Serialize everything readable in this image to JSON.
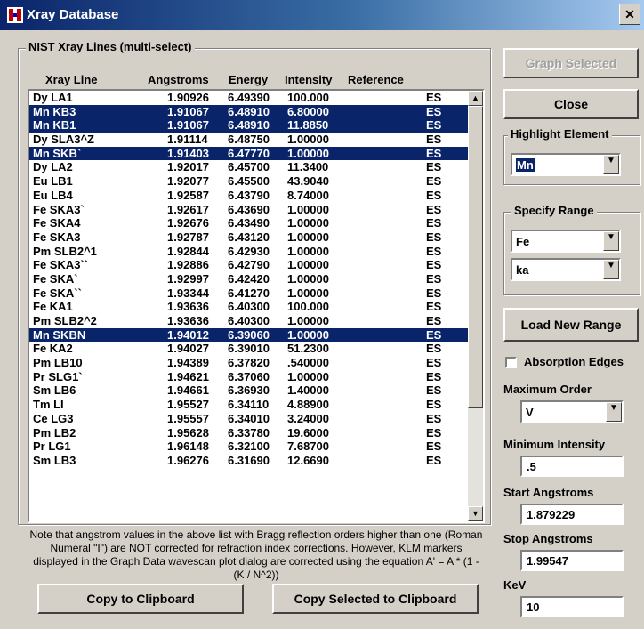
{
  "window": {
    "title": "Xray Database"
  },
  "group_nist": {
    "label": "NIST Xray Lines (multi-select)"
  },
  "columns": [
    "Xray Line",
    "Angstroms",
    "Energy",
    "Intensity",
    "Reference"
  ],
  "rows": [
    {
      "line": "Dy LA1",
      "ang": "1.90926",
      "energy": "6.49390",
      "intensity": "100.000",
      "ref": "ES",
      "selected": false
    },
    {
      "line": "Mn KB3",
      "ang": "1.91067",
      "energy": "6.48910",
      "intensity": "6.80000",
      "ref": "ES",
      "selected": true
    },
    {
      "line": "Mn KB1",
      "ang": "1.91067",
      "energy": "6.48910",
      "intensity": "11.8850",
      "ref": "ES",
      "selected": true
    },
    {
      "line": "Dy SLA3^Z",
      "ang": "1.91114",
      "energy": "6.48750",
      "intensity": "1.00000",
      "ref": "ES",
      "selected": false
    },
    {
      "line": "Mn SKB`",
      "ang": "1.91403",
      "energy": "6.47770",
      "intensity": "1.00000",
      "ref": "ES",
      "selected": true
    },
    {
      "line": "Dy LA2",
      "ang": "1.92017",
      "energy": "6.45700",
      "intensity": "11.3400",
      "ref": "ES",
      "selected": false
    },
    {
      "line": "Eu LB1",
      "ang": "1.92077",
      "energy": "6.45500",
      "intensity": "43.9040",
      "ref": "ES",
      "selected": false
    },
    {
      "line": "Eu LB4",
      "ang": "1.92587",
      "energy": "6.43790",
      "intensity": "8.74000",
      "ref": "ES",
      "selected": false
    },
    {
      "line": "Fe SKA3`",
      "ang": "1.92617",
      "energy": "6.43690",
      "intensity": "1.00000",
      "ref": "ES",
      "selected": false
    },
    {
      "line": "Fe SKA4",
      "ang": "1.92676",
      "energy": "6.43490",
      "intensity": "1.00000",
      "ref": "ES",
      "selected": false
    },
    {
      "line": "Fe SKA3",
      "ang": "1.92787",
      "energy": "6.43120",
      "intensity": "1.00000",
      "ref": "ES",
      "selected": false
    },
    {
      "line": "Pm SLB2^1",
      "ang": "1.92844",
      "energy": "6.42930",
      "intensity": "1.00000",
      "ref": "ES",
      "selected": false
    },
    {
      "line": "Fe SKA3``",
      "ang": "1.92886",
      "energy": "6.42790",
      "intensity": "1.00000",
      "ref": "ES",
      "selected": false
    },
    {
      "line": "Fe SKA`",
      "ang": "1.92997",
      "energy": "6.42420",
      "intensity": "1.00000",
      "ref": "ES",
      "selected": false
    },
    {
      "line": "Fe SKA``",
      "ang": "1.93344",
      "energy": "6.41270",
      "intensity": "1.00000",
      "ref": "ES",
      "selected": false
    },
    {
      "line": "Fe KA1",
      "ang": "1.93636",
      "energy": "6.40300",
      "intensity": "100.000",
      "ref": "ES",
      "selected": false
    },
    {
      "line": "Pm SLB2^2",
      "ang": "1.93636",
      "energy": "6.40300",
      "intensity": "1.00000",
      "ref": "ES",
      "selected": false
    },
    {
      "line": "Mn SKBN",
      "ang": "1.94012",
      "energy": "6.39060",
      "intensity": "1.00000",
      "ref": "ES",
      "selected": true
    },
    {
      "line": "Fe KA2",
      "ang": "1.94027",
      "energy": "6.39010",
      "intensity": "51.2300",
      "ref": "ES",
      "selected": false
    },
    {
      "line": "Pm LB10",
      "ang": "1.94389",
      "energy": "6.37820",
      "intensity": ".540000",
      "ref": "ES",
      "selected": false
    },
    {
      "line": "Pr SLG1`",
      "ang": "1.94621",
      "energy": "6.37060",
      "intensity": "1.00000",
      "ref": "ES",
      "selected": false
    },
    {
      "line": "Sm LB6",
      "ang": "1.94661",
      "energy": "6.36930",
      "intensity": "1.40000",
      "ref": "ES",
      "selected": false
    },
    {
      "line": "Tm LI",
      "ang": "1.95527",
      "energy": "6.34110",
      "intensity": "4.88900",
      "ref": "ES",
      "selected": false
    },
    {
      "line": "Ce LG3",
      "ang": "1.95557",
      "energy": "6.34010",
      "intensity": "3.24000",
      "ref": "ES",
      "selected": false
    },
    {
      "line": "Pm LB2",
      "ang": "1.95628",
      "energy": "6.33780",
      "intensity": "19.6000",
      "ref": "ES",
      "selected": false
    },
    {
      "line": "Pr LG1",
      "ang": "1.96148",
      "energy": "6.32100",
      "intensity": "7.68700",
      "ref": "ES",
      "selected": false
    },
    {
      "line": "Sm LB3",
      "ang": "1.96276",
      "energy": "6.31690",
      "intensity": "12.6690",
      "ref": "ES",
      "selected": false
    }
  ],
  "note": "Note that angstrom values in the above list with Bragg reflection orders higher than one (Roman Numeral \"I\") are NOT corrected for refraction index corrections. However, KLM markers displayed in the Graph Data wavescan plot dialog are corrected using the equation A' = A * (1 - (K / N^2))",
  "buttons": {
    "copy": "Copy to Clipboard",
    "copy_selected": "Copy Selected to Clipboard",
    "graph_selected": "Graph Selected",
    "close": "Close",
    "load_range": "Load New Range"
  },
  "highlight": {
    "label": "Highlight Element",
    "value": "Mn"
  },
  "range": {
    "label": "Specify Range",
    "element": "Fe",
    "line": "ka"
  },
  "absorption": {
    "label": "Absorption Edges",
    "checked": false
  },
  "max_order": {
    "label": "Maximum Order",
    "value": "V"
  },
  "min_intensity": {
    "label": "Minimum Intensity",
    "value": ".5"
  },
  "start_ang": {
    "label": "Start Angstroms",
    "value": "1.879229"
  },
  "stop_ang": {
    "label": "Stop Angstroms",
    "value": "1.99547"
  },
  "kev": {
    "label": "KeV",
    "value": "10"
  },
  "icons": {
    "app": "xray-app-icon",
    "close": "close-icon",
    "dropdown": "chevron-down-icon"
  },
  "colors": {
    "selection": "#0a246a",
    "face": "#d4d0c8"
  }
}
